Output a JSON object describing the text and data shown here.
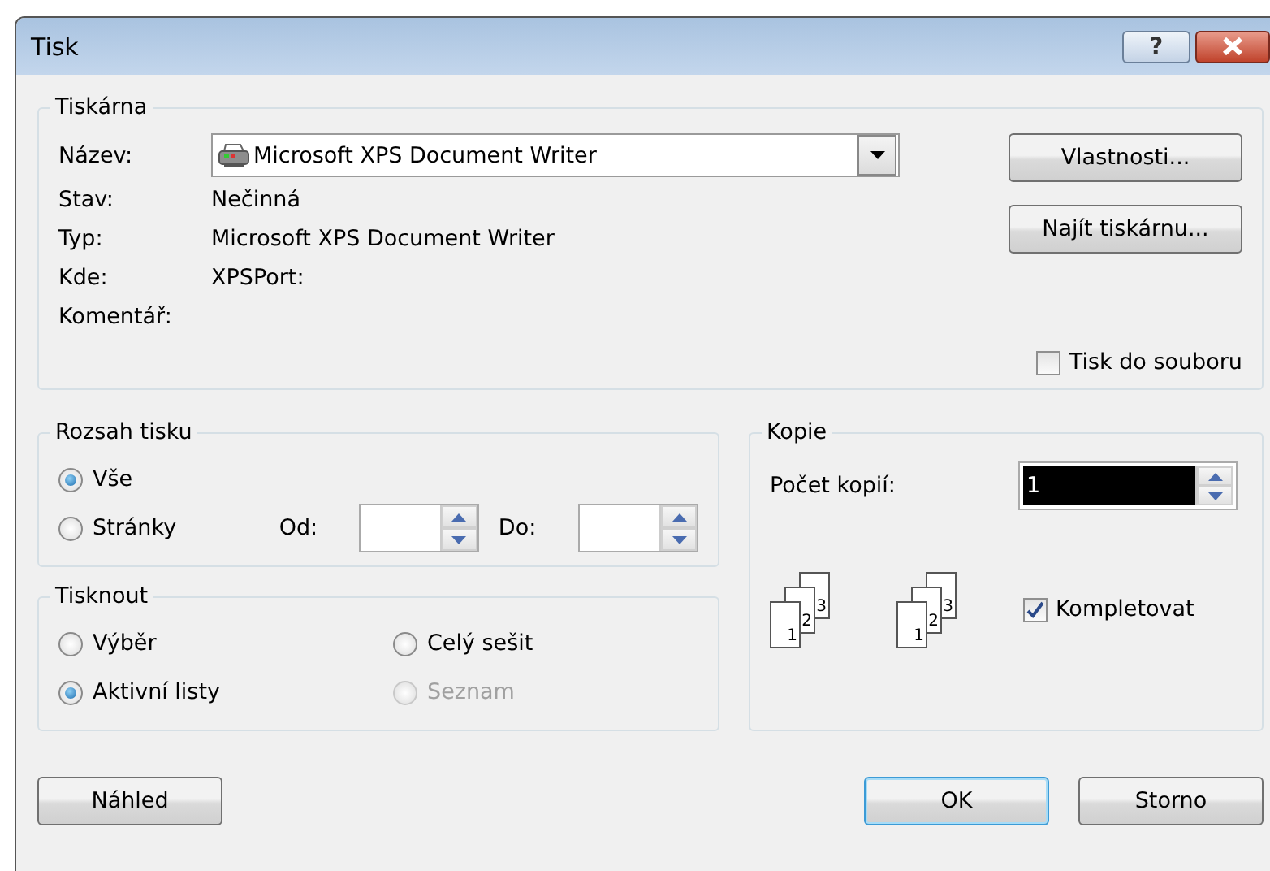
{
  "window": {
    "title": "Tisk",
    "help": "?"
  },
  "printer": {
    "legend": "Tiskárna",
    "name_label": "Název:",
    "name_value": "Microsoft XPS Document Writer",
    "info": [
      {
        "label": "Stav:",
        "value": "Nečinná"
      },
      {
        "label": "Typ:",
        "value": "Microsoft XPS Document Writer"
      },
      {
        "label": "Kde:",
        "value": "XPSPort:"
      },
      {
        "label": "Komentář:"
      }
    ],
    "buttons": [
      "Vlastnosti...",
      "Najít tiskárnu..."
    ],
    "print_to_file": {
      "label": "Tisk do souboru",
      "checked": false
    }
  },
  "range": {
    "legend": "Rozsah tisku",
    "options": [
      {
        "label": "Vše",
        "selected": true
      },
      {
        "label": "Stránky",
        "selected": false
      }
    ],
    "from_label": "Od:",
    "to_label": "Do:"
  },
  "print_what": {
    "legend": "Tisknout",
    "options": [
      {
        "label": "Výběr",
        "selected": false,
        "disabled": false
      },
      {
        "label": "Celý sešit",
        "selected": false,
        "disabled": false
      },
      {
        "label": "Aktivní listy",
        "selected": true,
        "disabled": false
      },
      {
        "label": "Seznam",
        "selected": false,
        "disabled": true
      }
    ]
  },
  "copies": {
    "legend": "Kopie",
    "count_label": "Počet kopií:",
    "count_value": "1",
    "count_highlighted": true,
    "stacks": [
      {
        "pages": [
          "1",
          "2",
          "3"
        ]
      },
      {
        "pages": [
          "1",
          "2",
          "3"
        ]
      }
    ],
    "collate": {
      "label": "Kompletovat",
      "checked": true
    }
  },
  "footer": [
    {
      "label": "Náhled",
      "default": false
    },
    {
      "label": "OK",
      "default": true
    },
    {
      "label": "Storno",
      "default": false
    }
  ]
}
